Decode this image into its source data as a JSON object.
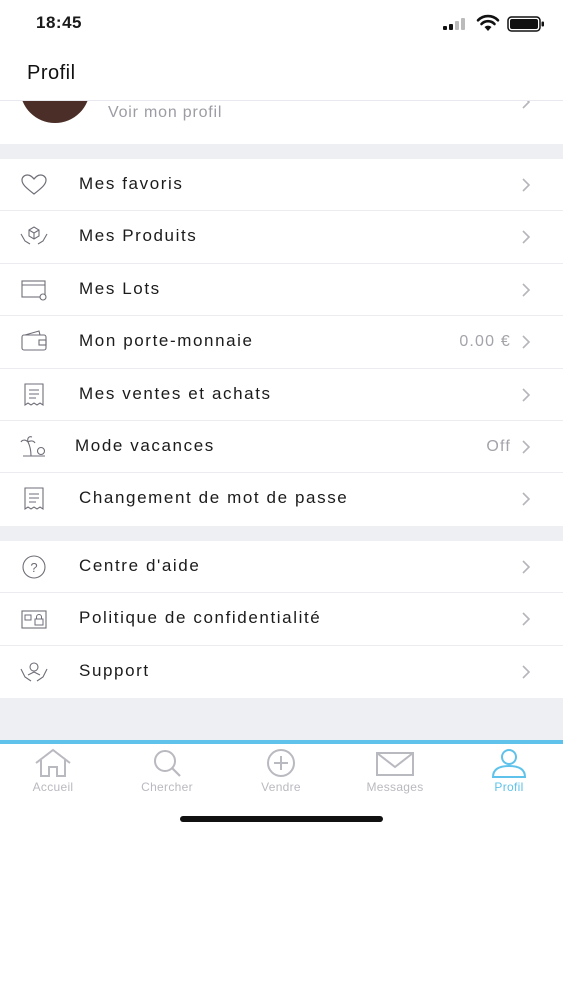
{
  "status_bar": {
    "time": "18:45"
  },
  "header": {
    "title": "Profil"
  },
  "profile": {
    "link_label": "Voir mon profil"
  },
  "menu_group_1": [
    {
      "id": "favoris",
      "label": "Mes favoris",
      "icon": "heart-icon",
      "value": ""
    },
    {
      "id": "produits",
      "label": "Mes Produits",
      "icon": "hands-box-icon",
      "value": ""
    },
    {
      "id": "lots",
      "label": "Mes Lots",
      "icon": "box-icon",
      "value": ""
    },
    {
      "id": "porte-monnaie",
      "label": "Mon porte-monnaie",
      "icon": "wallet-icon",
      "value": "0.00 €"
    },
    {
      "id": "ventes-achats",
      "label": "Mes ventes et achats",
      "icon": "receipt-icon",
      "value": ""
    },
    {
      "id": "vacances",
      "label": "Mode vacances",
      "icon": "palm-tree-icon",
      "value": "Off"
    },
    {
      "id": "mot-de-passe",
      "label": "Changement de mot de passe",
      "icon": "receipt-icon",
      "value": ""
    }
  ],
  "menu_group_2": [
    {
      "id": "aide",
      "label": "Centre d'aide",
      "icon": "help-circle-icon"
    },
    {
      "id": "confidentialite",
      "label": "Politique de confidentialité",
      "icon": "lock-id-card-icon"
    },
    {
      "id": "support",
      "label": "Support",
      "icon": "support-hands-icon"
    }
  ],
  "tab_bar": {
    "tabs": [
      {
        "label": "Accueil",
        "icon": "home-icon",
        "active": false
      },
      {
        "label": "Chercher",
        "icon": "search-icon",
        "active": false
      },
      {
        "label": "Vendre",
        "icon": "plus-circle-icon",
        "active": false
      },
      {
        "label": "Messages",
        "icon": "envelope-icon",
        "active": false
      },
      {
        "label": "Profil",
        "icon": "user-icon",
        "active": true
      }
    ]
  },
  "colors": {
    "accent": "#5ec2ea",
    "section_gap": "#eeeff3",
    "muted_text": "#a3a3aa"
  }
}
